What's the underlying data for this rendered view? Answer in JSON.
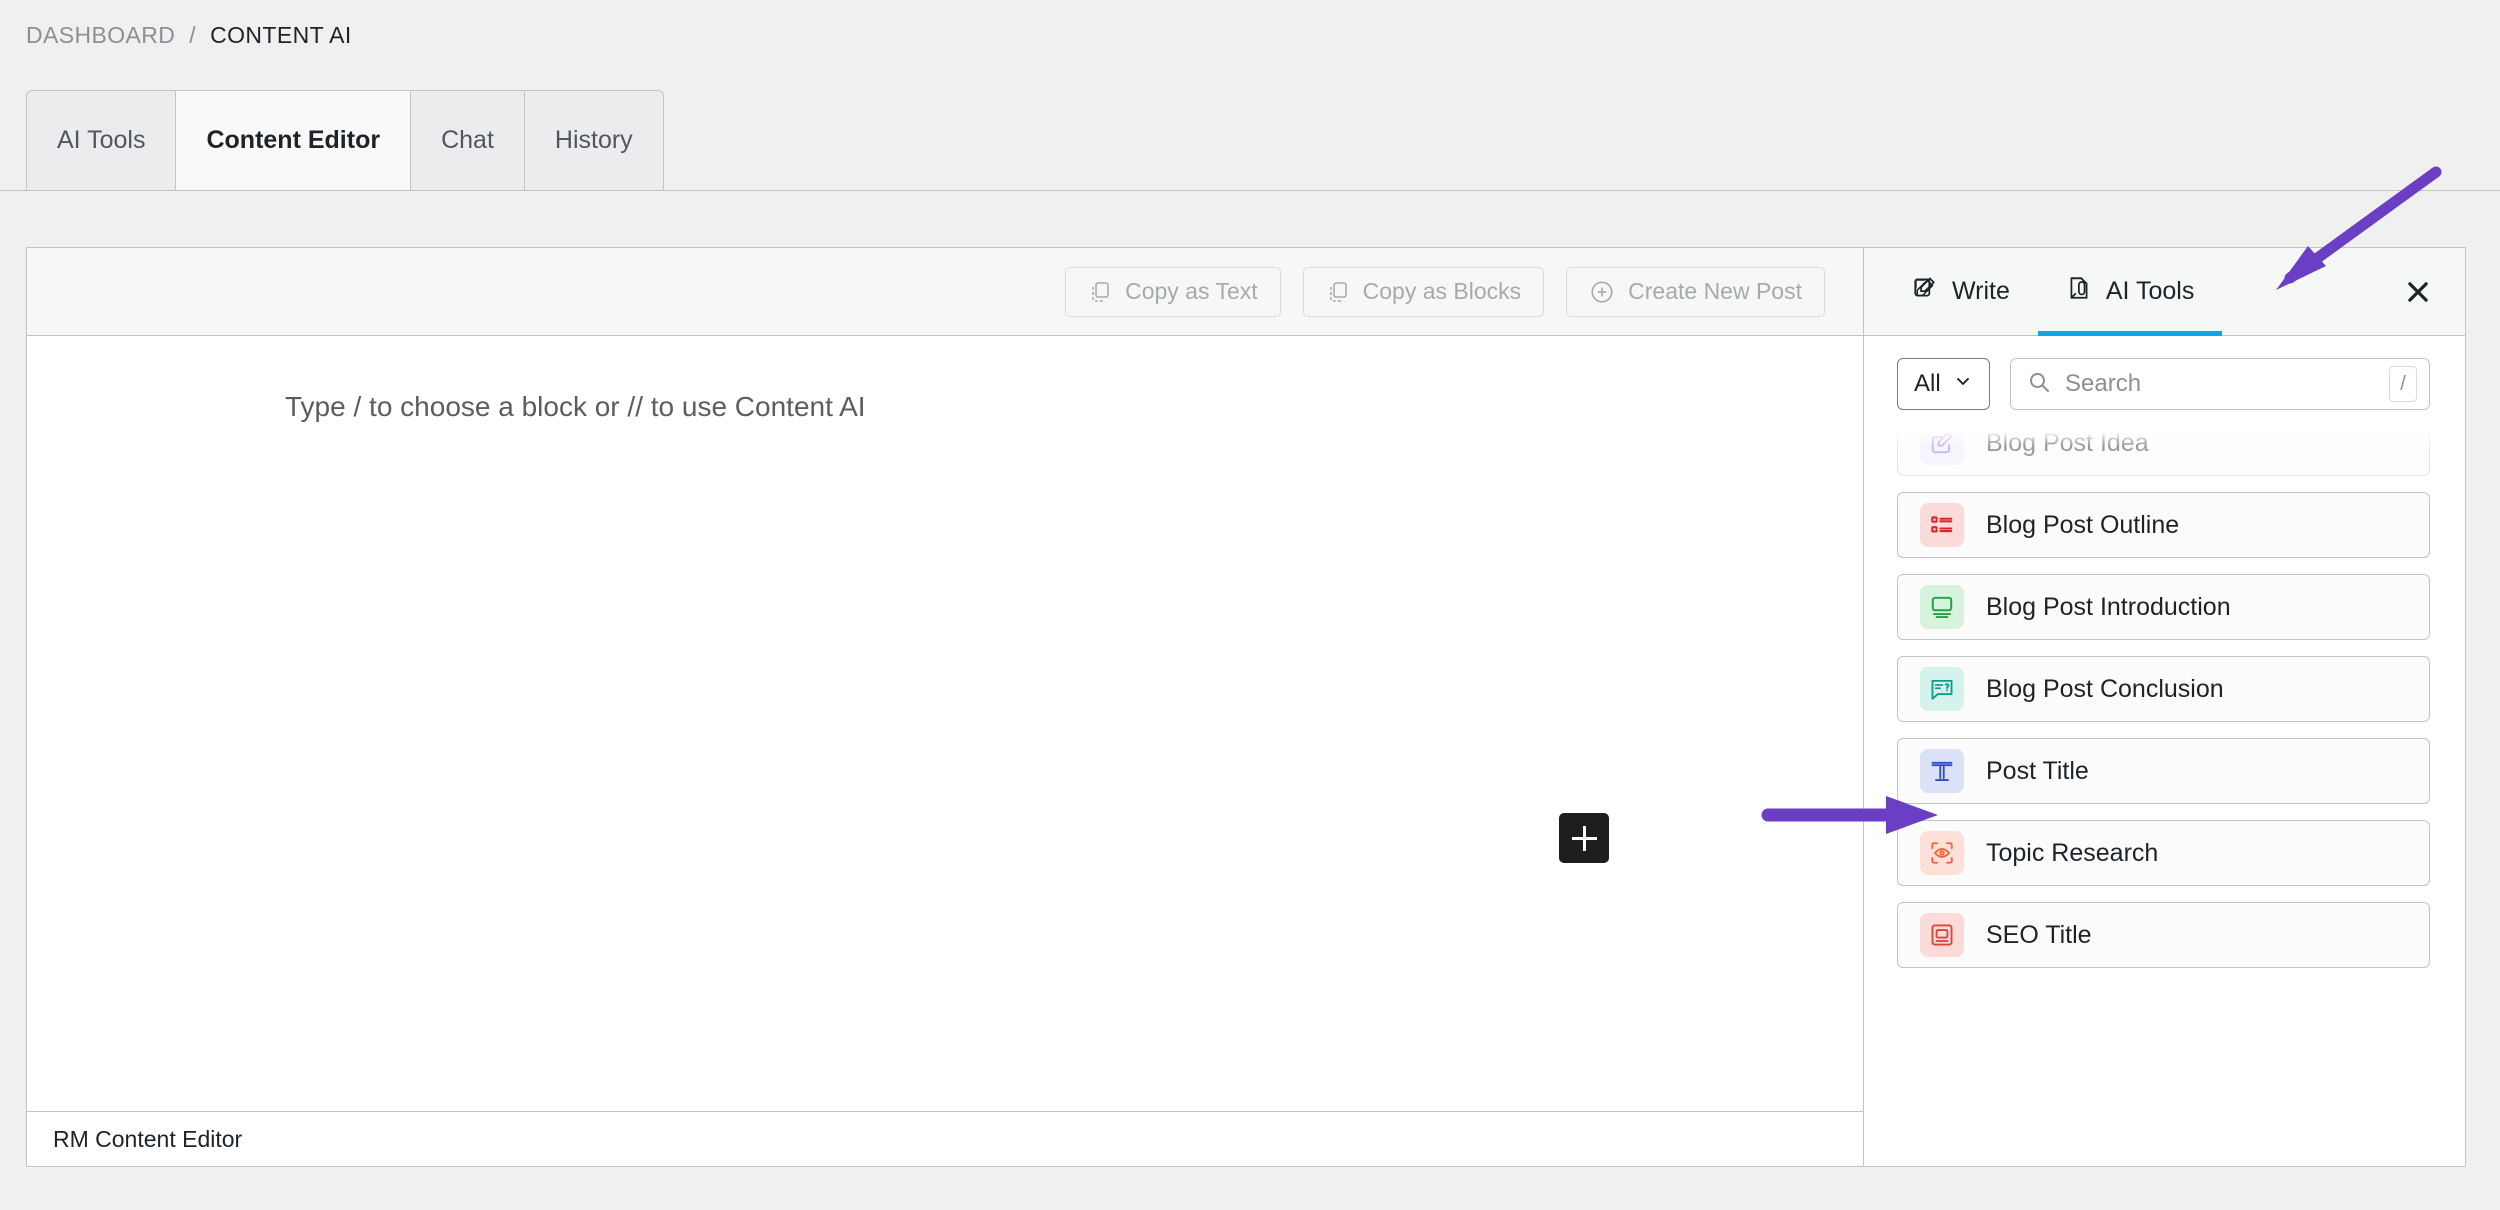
{
  "breadcrumb": {
    "parent": "DASHBOARD",
    "separator": "/",
    "current": "CONTENT AI"
  },
  "tabs": [
    {
      "label": "AI Tools",
      "active": false
    },
    {
      "label": "Content Editor",
      "active": true
    },
    {
      "label": "Chat",
      "active": false
    },
    {
      "label": "History",
      "active": false
    }
  ],
  "editor": {
    "toolbar": [
      {
        "label": "Copy as Text",
        "icon": "copy-icon"
      },
      {
        "label": "Copy as Blocks",
        "icon": "copy-blocks-icon"
      },
      {
        "label": "Create New Post",
        "icon": "plus-circle-icon"
      }
    ],
    "placeholder": "Type / to choose a block or // to use Content AI",
    "inserter_icon": "plus-icon",
    "footer_label": "RM Content Editor"
  },
  "ai_sidebar": {
    "tabs": [
      {
        "label": "Write",
        "icon": "write-pencil-icon",
        "active": false
      },
      {
        "label": "AI Tools",
        "icon": "ai-document-icon",
        "active": true
      }
    ],
    "close_icon": "close-icon",
    "active_indicator_color": "#0ea5e9",
    "filter": {
      "selected": "All",
      "chevron_icon": "chevron-down-icon"
    },
    "search": {
      "placeholder": "Search",
      "value": "",
      "icon": "search-icon",
      "shortcut_key": "/"
    },
    "tools": [
      {
        "label": "Blog Post Idea",
        "icon": "pencil-square-icon",
        "icon_color": "#8b5cf6",
        "icon_bg": "#ede9fe",
        "faded": true
      },
      {
        "label": "Blog Post Outline",
        "icon": "list-icon",
        "icon_color": "#dc2626",
        "icon_bg": "#fbdada",
        "faded": false
      },
      {
        "label": "Blog Post Introduction",
        "icon": "monitor-icon",
        "icon_color": "#22a043",
        "icon_bg": "#d8f3dd",
        "faded": false
      },
      {
        "label": "Blog Post Conclusion",
        "icon": "chat-question-icon",
        "icon_color": "#0f9b8e",
        "icon_bg": "#d6f2ec",
        "faded": false
      },
      {
        "label": "Post Title",
        "icon": "text-title-icon",
        "icon_color": "#2d4cc8",
        "icon_bg": "#dbe2f8",
        "faded": false
      },
      {
        "label": "Topic Research",
        "icon": "eye-scan-icon",
        "icon_color": "#f4633a",
        "icon_bg": "#fde0d8",
        "faded": false
      },
      {
        "label": "SEO Title",
        "icon": "seo-title-icon",
        "icon_color": "#e0413a",
        "icon_bg": "#fbdada",
        "faded": false
      }
    ]
  },
  "annotations": {
    "color": "#6b3fc4",
    "arrows": [
      {
        "name": "arrow-to-ai-tools-tab",
        "points_to": "AI Tools"
      },
      {
        "name": "arrow-to-blog-post-conclusion",
        "points_to": "Blog Post Conclusion"
      }
    ]
  }
}
